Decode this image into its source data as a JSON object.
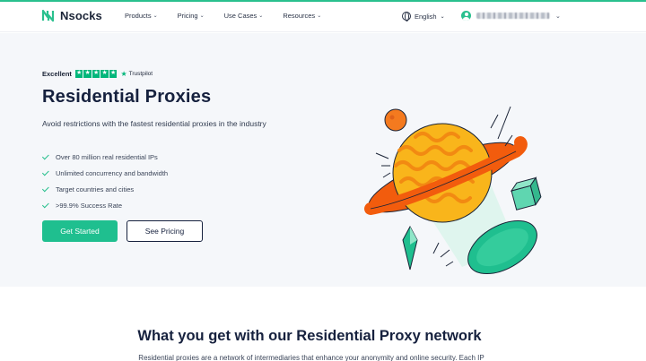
{
  "brand": {
    "name": "Nsocks",
    "accent": "#29c08e"
  },
  "nav": {
    "items": [
      {
        "label": "Products"
      },
      {
        "label": "Pricing"
      },
      {
        "label": "Use Cases"
      },
      {
        "label": "Resources"
      }
    ],
    "language": "English"
  },
  "hero": {
    "rating_label": "Excellent",
    "rating_stars": 5,
    "rating_brand": "Trustpilot",
    "title": "Residential Proxies",
    "subtitle": "Avoid restrictions with the fastest residential proxies in the industry",
    "features": [
      "Over 80 million real residential IPs",
      "Unlimited concurrency and bandwidth",
      "Target countries and cities",
      ">99.9% Success Rate"
    ],
    "primary_cta": "Get Started",
    "secondary_cta": "See Pricing"
  },
  "section": {
    "title": "What you get with our Residential Proxy network",
    "subtitle": "Residential proxies are a network of intermediaries that enhance your anonymity and online security. Each IP"
  },
  "icons": [
    "logo-icon",
    "chevron-down-icon",
    "globe-icon",
    "user-icon",
    "star-icon",
    "check-icon"
  ]
}
